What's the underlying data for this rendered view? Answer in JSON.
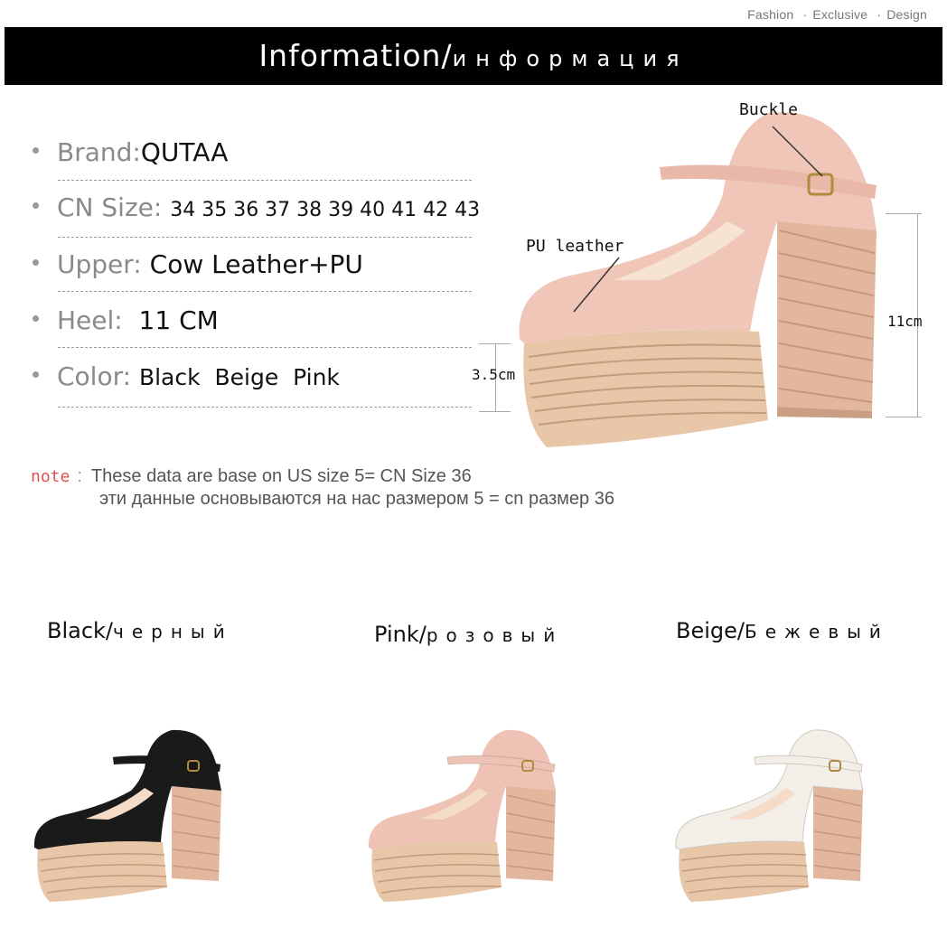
{
  "tagline": {
    "w1": "Fashion",
    "w2": "Exclusive",
    "w3": "Design"
  },
  "banner": {
    "title_en": "Information/",
    "title_ru": "информация"
  },
  "specs": {
    "brand": {
      "label": "Brand:",
      "value": "QUTAA"
    },
    "size": {
      "label": "CN Size:",
      "value": "34 35 36 37 38 39 40 41 42 43"
    },
    "upper": {
      "label": "Upper:",
      "value": "Cow Leather+PU"
    },
    "heel": {
      "label": "Heel:",
      "value": "11 CM"
    },
    "color": {
      "label": "Color:",
      "value": "Black  Beige  Pink"
    }
  },
  "callouts": {
    "buckle": "Buckle",
    "pu": "PU leather",
    "platform": "3.5cm",
    "heel": "11cm"
  },
  "note": {
    "label": "note",
    "colon": ":",
    "line1": "These data are base on US size 5= CN Size 36",
    "line2": "эти данные основываются на нас размером 5 = cn размер 36"
  },
  "variants": [
    {
      "en": "Black/",
      "ru": "черный",
      "color": "#1a1a1a"
    },
    {
      "en": "Pink/",
      "ru": "розовый",
      "color": "#eec3b6"
    },
    {
      "en": "Beige/",
      "ru": "Бежевый",
      "color": "#f3efe8"
    }
  ],
  "colors": {
    "pink_leather": "#efc6b8",
    "platform": "#e6c3a6",
    "note_label": "#e05050"
  }
}
